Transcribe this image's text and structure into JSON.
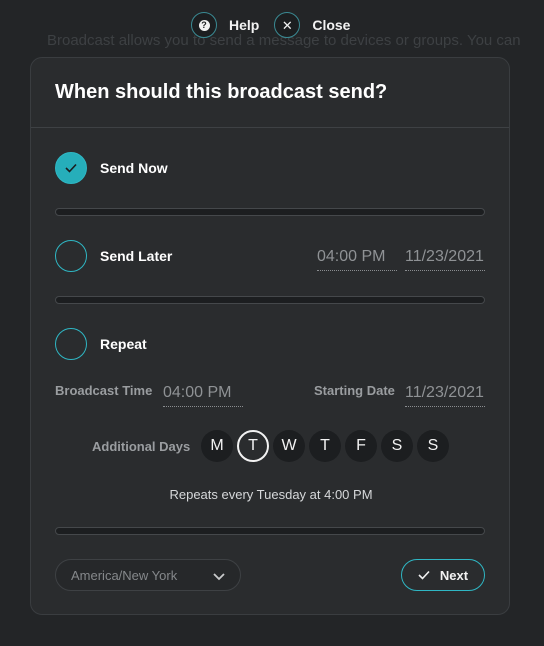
{
  "background": {
    "description_text": "Broadcast allows you to send a message to devices or groups. You can"
  },
  "topbar": {
    "help_label": "Help",
    "close_label": "Close"
  },
  "modal": {
    "title": "When should this broadcast send?",
    "options": {
      "send_now": {
        "label": "Send Now",
        "selected": true
      },
      "send_later": {
        "label": "Send Later",
        "time": "04:00 PM",
        "date": "11/23/2021",
        "selected": false
      },
      "repeat": {
        "label": "Repeat",
        "selected": false,
        "broadcast_time_label": "Broadcast Time",
        "broadcast_time": "04:00 PM",
        "starting_date_label": "Starting Date",
        "starting_date": "11/23/2021",
        "additional_days_label": "Additional Days",
        "days": [
          "M",
          "T",
          "W",
          "T",
          "F",
          "S",
          "S"
        ],
        "selected_day_index": 1,
        "summary": "Repeats every Tuesday at 4:00 PM"
      }
    },
    "footer": {
      "timezone": "America/New York",
      "next_label": "Next"
    }
  },
  "colors": {
    "accent": "#26aeba",
    "background": "#232527",
    "modal": "#2a2c2e"
  }
}
